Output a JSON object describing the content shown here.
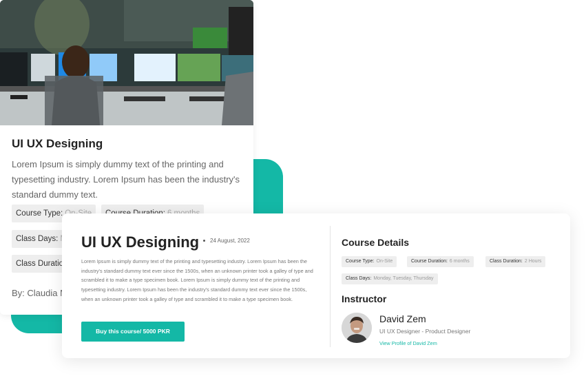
{
  "colors": {
    "accent": "#14b8a6",
    "chip_bg": "#eeeeee"
  },
  "back_card": {
    "image": "control-room-photo",
    "title": "UI UX Designing",
    "description": "Lorem Ipsum is simply dummy text of the printing and typesetting industry. Lorem Ipsum has been the industry's standard dummy text.",
    "chips": [
      {
        "label": "Course Type:",
        "value": "On-Site"
      },
      {
        "label": "Course Duration:",
        "value": "6 months"
      },
      {
        "label": "Class Days:",
        "value": "M"
      },
      {
        "label": "Class Duration",
        "value": ""
      }
    ],
    "by": "By: Claudia M"
  },
  "front_card": {
    "title": "UI UX Designing",
    "date": "24 August, 2022",
    "description": "Lorem Ipsum is simply dummy text of the printing and typesetting industry. Lorem Ipsum has been the industry's standard dummy text ever since the 1500s, when an unknown printer took a galley of type and scrambled it to make a type specimen book.  Lorem Ipsum is simply dummy text of the printing and typesetting industry. Lorem Ipsum has been the industry's standard dummy text ever since the 1500s, when an unknown printer took a galley of type and scrambled it to make a type specimen book.",
    "buy_label": "Buy this course/ 5000 PKR",
    "details_heading": "Course Details",
    "details": [
      {
        "label": "Course Type:",
        "value": "On-Site"
      },
      {
        "label": "Course Duration:",
        "value": "6 months"
      },
      {
        "label": "Class Duration:",
        "value": "2 Hours"
      },
      {
        "label": "Class Days:",
        "value": "Monday, Tuesday, Thursday"
      }
    ],
    "instructor_heading": "Instructor",
    "instructor": {
      "name": "David Zem",
      "role": "UI UX Designer - Product Designer",
      "profile_link": "View Profile of David Zem"
    }
  }
}
